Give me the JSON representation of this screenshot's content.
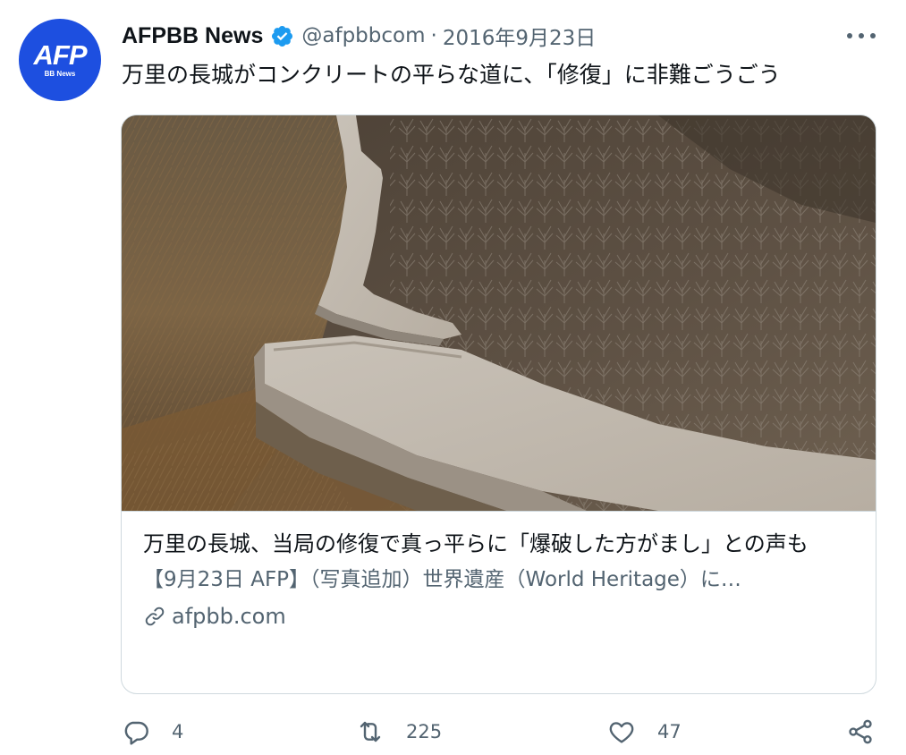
{
  "account": {
    "avatar_text": "AFP",
    "avatar_subtext": "BB News",
    "name": "AFPBB News",
    "handle": "@afpbbcom",
    "separator": "·",
    "date": "2016年9月23日",
    "verified_icon": "verified-badge-icon"
  },
  "tweet": {
    "text": "万里の長城がコンクリートの平らな道に、「修復」に非難ごうごう"
  },
  "card": {
    "image_subject": "great-wall-photo",
    "title": "万里の長城、当局の修復で真っ平らに「爆破した方がまし」との声も",
    "description": "【9月23日 AFP】（写真追加）世界遺産（World Heritage）に…",
    "domain": "afpbb.com",
    "domain_icon": "link-icon"
  },
  "actions": {
    "reply_count": "4",
    "retweet_count": "225",
    "like_count": "47",
    "reply_icon": "reply-icon",
    "retweet_icon": "retweet-icon",
    "like_icon": "heart-icon",
    "share_icon": "share-icon"
  },
  "colors": {
    "avatar_bg": "#1d4fe0",
    "verified_blue": "#1d9bf0",
    "secondary_text": "#536471",
    "border": "#cfd9de"
  }
}
